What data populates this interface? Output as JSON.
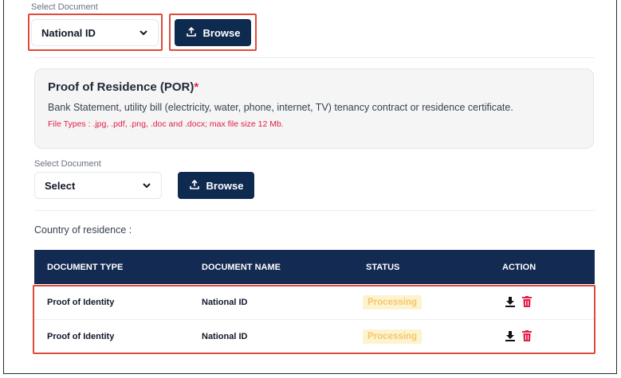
{
  "top_select": {
    "label": "Select Document",
    "value": "National ID",
    "browse_label": "Browse"
  },
  "por": {
    "title": "Proof of Residence (POR)",
    "required_mark": "*",
    "description": "Bank Statement, utility bill (electricity, water, phone, internet, TV) tenancy contract or residence certificate.",
    "file_types": "File Types : .jpg, .pdf, .png, .doc and .docx; max file size 12 Mb."
  },
  "por_select": {
    "label": "Select Document",
    "value": "Select",
    "browse_label": "Browse"
  },
  "country_label": "Country of residence :",
  "table": {
    "headers": [
      "DOCUMENT TYPE",
      "DOCUMENT NAME",
      "STATUS",
      "ACTION"
    ],
    "rows": [
      {
        "type": "Proof of Identity",
        "name": "National ID",
        "status": "Processing"
      },
      {
        "type": "Proof of Identity",
        "name": "National ID",
        "status": "Processing"
      }
    ]
  },
  "icons": {
    "chevron": "chevron-down-icon",
    "upload": "upload-icon",
    "download": "download-icon",
    "delete": "trash-icon"
  },
  "colors": {
    "primary": "#0f2a4f",
    "table_header": "#132a52",
    "highlight": "#e04a3a",
    "required": "#e11d48",
    "status_bg": "#fdf3cf",
    "status_text": "#f6c66b",
    "delete_icon": "#e11d48"
  }
}
